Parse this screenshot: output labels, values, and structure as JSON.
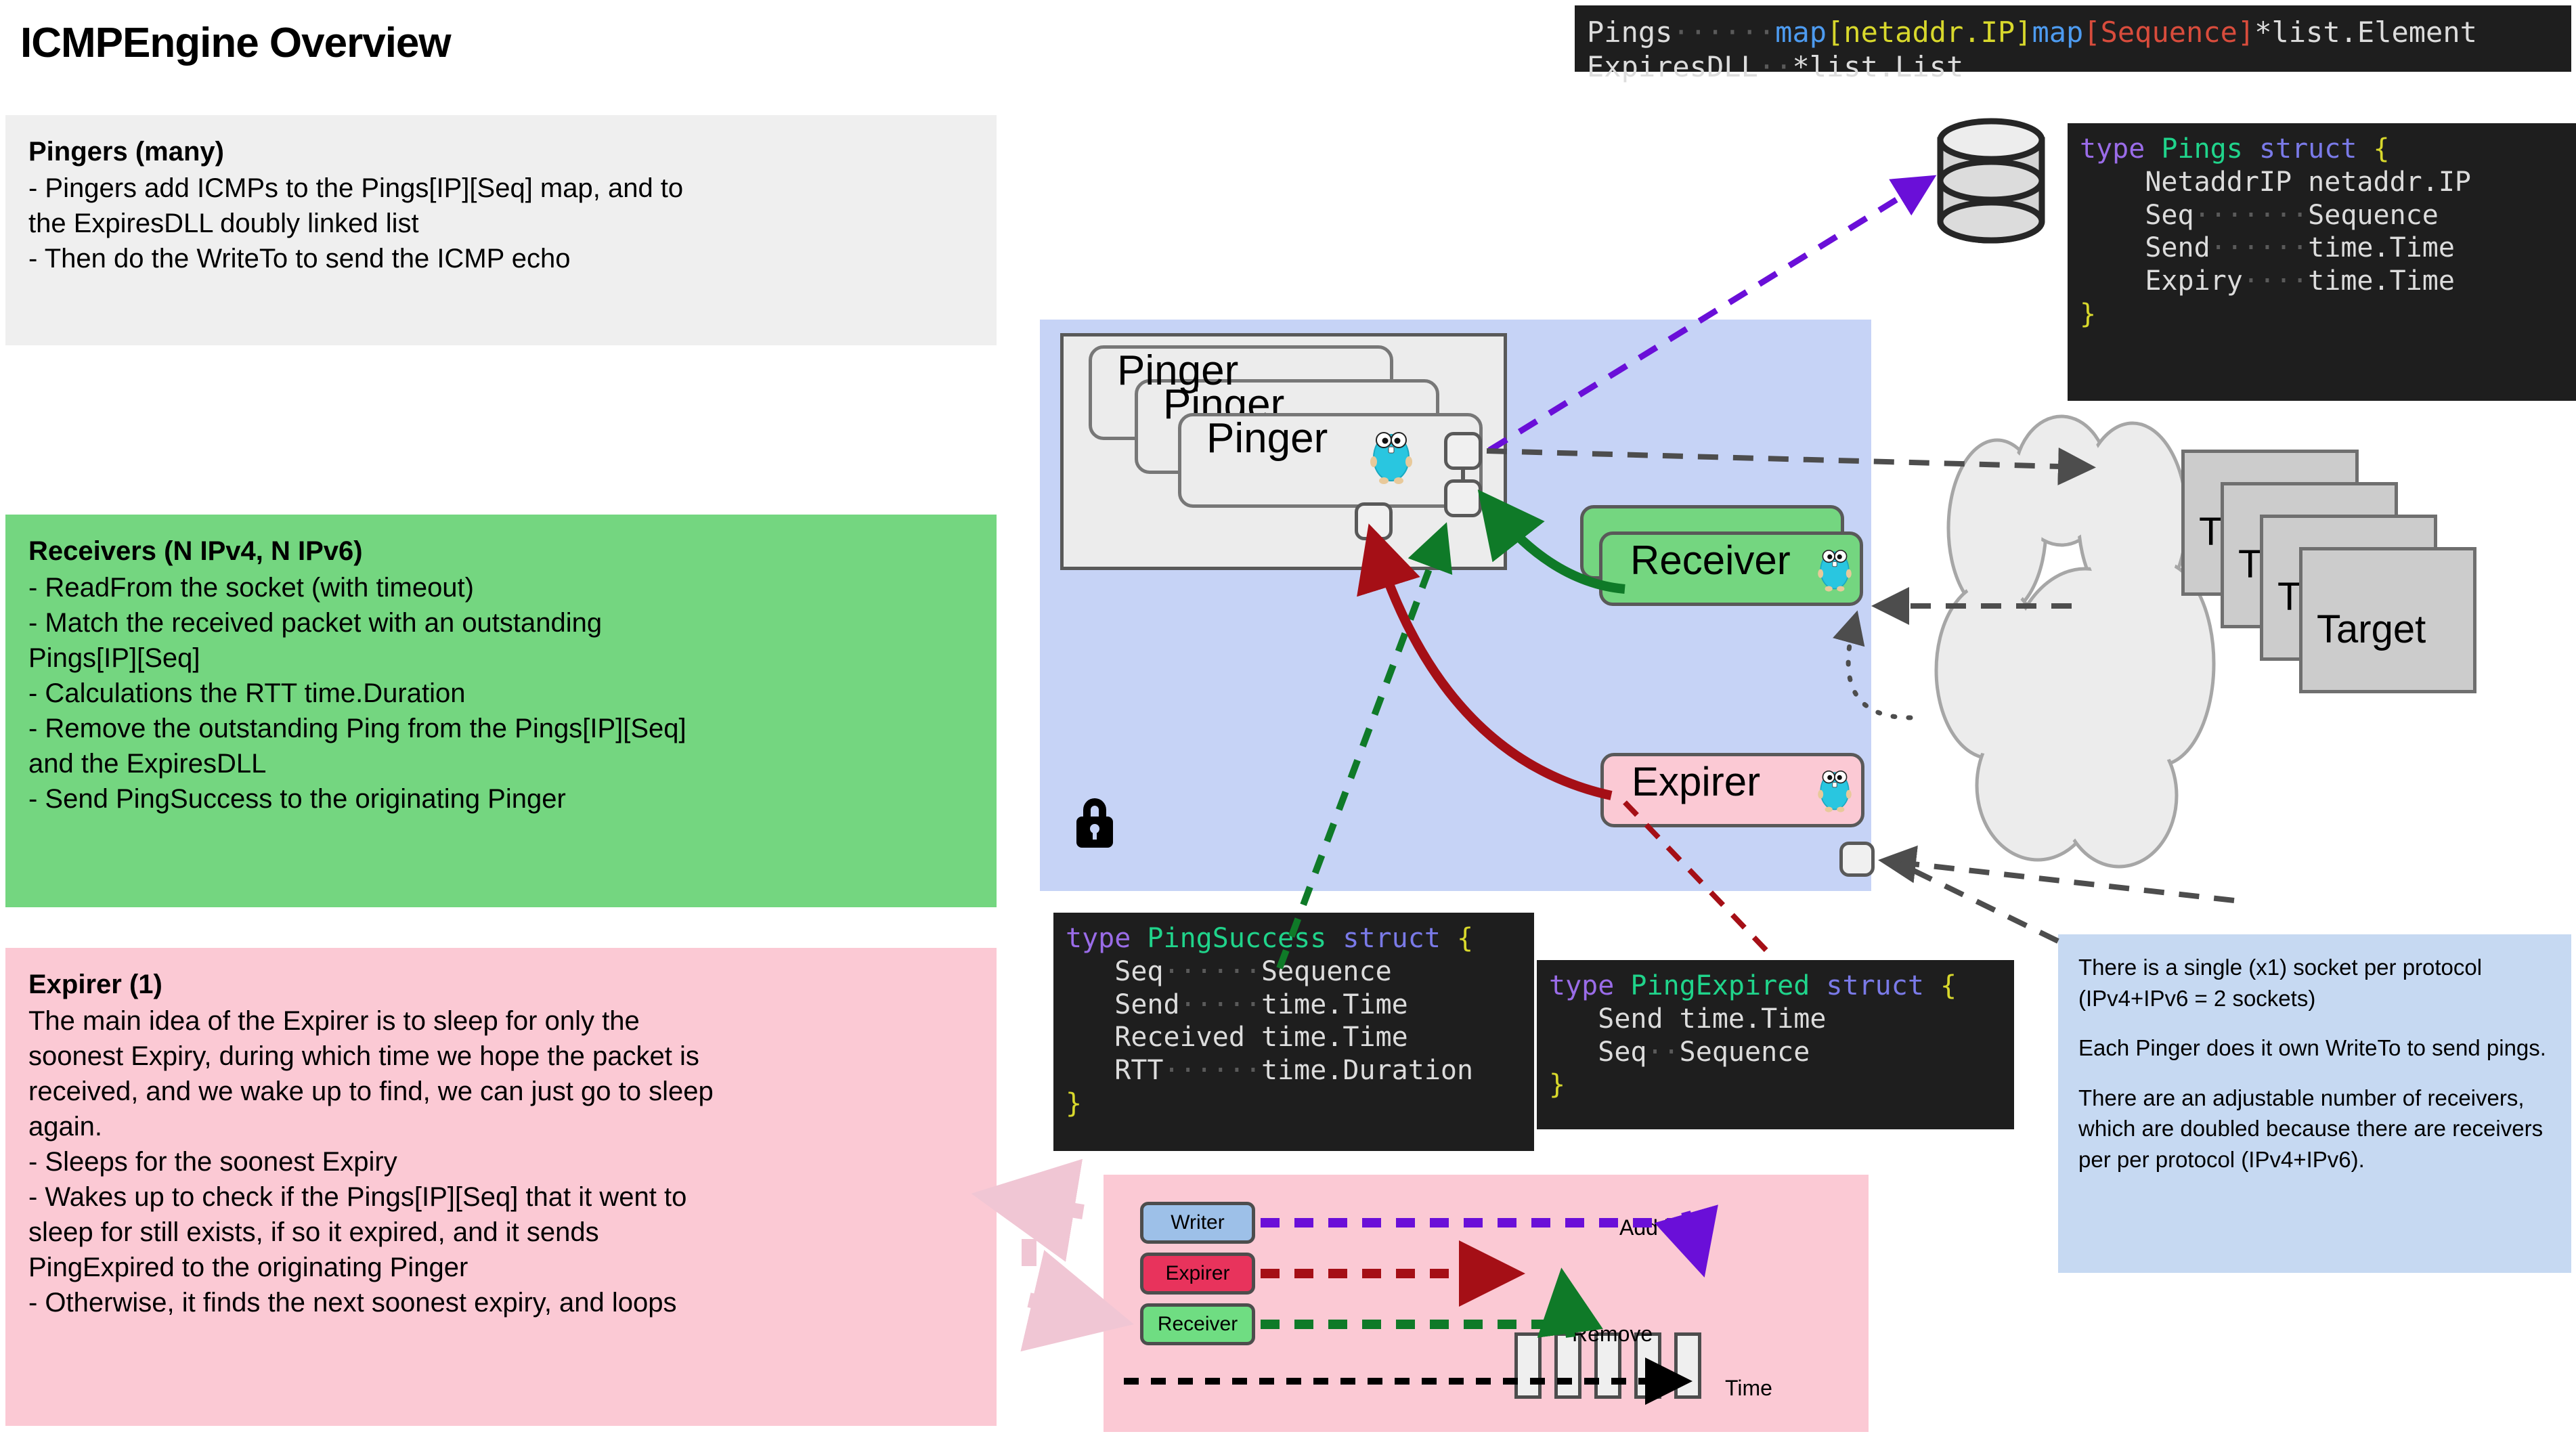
{
  "title": "ICMPEngine Overview",
  "panels": {
    "pingers": {
      "heading": "Pingers (many)",
      "lines": [
        "- Pingers add ICMPs to the Pings[IP][Seq] map, and to",
        "the ExpiresDLL doubly linked list",
        "- Then do the WriteTo to send the ICMP echo"
      ]
    },
    "receivers": {
      "heading": "Receivers (N IPv4, N IPv6)",
      "lines": [
        "- ReadFrom the socket (with timeout)",
        "- Match the received packet with an outstanding",
        "Pings[IP][Seq]",
        "- Calculations the RTT time.Duration",
        "- Remove the outstanding Ping from the Pings[IP][Seq]",
        "and the ExpiresDLL",
        "- Send PingSuccess to the originating Pinger"
      ]
    },
    "expirer": {
      "heading": "Expirer (1)",
      "lines": [
        "The main idea of the Expirer is to sleep for only the",
        "soonest Expiry, during which time we hope the packet is",
        "received, and we wake up to find, we can just go to sleep",
        "again.",
        "- Sleeps for the soonest Expiry",
        "- Wakes up to check if the Pings[IP][Seq] that it went to",
        "sleep for still exists, if so it expired, and it sends",
        "PingExpired to the originating Pinger",
        "- Otherwise, it finds the next soonest expiry, and loops"
      ]
    }
  },
  "engine": {
    "pinger_labels": [
      "Pinger",
      "Pinger",
      "Pinger"
    ],
    "receiver_label": "Receiver",
    "expirer_label": "Expirer",
    "target_labels": [
      "T",
      "T",
      "T",
      "Target"
    ]
  },
  "code": {
    "pings_map": {
      "line1_name": "Pings",
      "line1_dots": "······",
      "line1_map1": "map",
      "line1_key1": "[netaddr.IP]",
      "line1_map2": "map",
      "line1_key2": "[Sequence]",
      "line1_val": "*list.Element",
      "line2_name": "ExpiresDLL",
      "line2_dots": "··",
      "line2_val": "*list.List"
    },
    "pings_struct": {
      "kw_type": "type",
      "name": "Pings",
      "kw_struct": "struct",
      "open": "{",
      "close": "}",
      "fields": [
        {
          "name": "NetaddrIP",
          "gap": " ",
          "type": "netaddr.IP"
        },
        {
          "name": "Seq",
          "gap": "·······",
          "type": "Sequence"
        },
        {
          "name": "Send",
          "gap": "······",
          "type": "time.Time"
        },
        {
          "name": "Expiry",
          "gap": "····",
          "type": "time.Time"
        }
      ]
    },
    "ping_success": {
      "kw_type": "type",
      "name": "PingSuccess",
      "kw_struct": "struct",
      "open": "{",
      "close": "}",
      "fields": [
        {
          "name": "Seq",
          "gap": "······",
          "type": "Sequence"
        },
        {
          "name": "Send",
          "gap": "·····",
          "type": "time.Time"
        },
        {
          "name": "Received",
          "gap": " ",
          "type": "time.Time"
        },
        {
          "name": "RTT",
          "gap": "······",
          "type": "time.Duration"
        }
      ]
    },
    "ping_expired": {
      "kw_type": "type",
      "name": "PingExpired",
      "kw_struct": "struct",
      "open": "{",
      "close": "}",
      "fields": [
        {
          "name": "Send",
          "gap": " ",
          "type": "time.Time"
        },
        {
          "name": "Seq",
          "gap": "··",
          "type": "Sequence"
        }
      ]
    }
  },
  "note": {
    "paragraphs": [
      "There is a single (x1) socket per protocol (IPv4+IPv6 = 2 sockets)",
      "Each Pinger does it own WriteTo to send pings.",
      "There are an adjustable number of receivers, which are doubled because there are receivers per per protocol (IPv4+IPv6)."
    ]
  },
  "timeline": {
    "writer_label": "Writer",
    "expirer_label": "Expirer",
    "receiver_label": "Receiver",
    "add_back_label": "Add  back",
    "remove_label": "Remove",
    "time_label": "Time",
    "slot_count": 5
  },
  "colors": {
    "green": "#74d680",
    "pink": "#fbc9d4",
    "blue_panel": "#c6d3f6",
    "note_blue": "#c6d9f2",
    "gray_panel": "#efefef",
    "arrow_red": "#a50f16",
    "arrow_green": "#0f7a28",
    "arrow_purple": "#6a0fd8",
    "arrow_gray": "#4d4d4d"
  }
}
